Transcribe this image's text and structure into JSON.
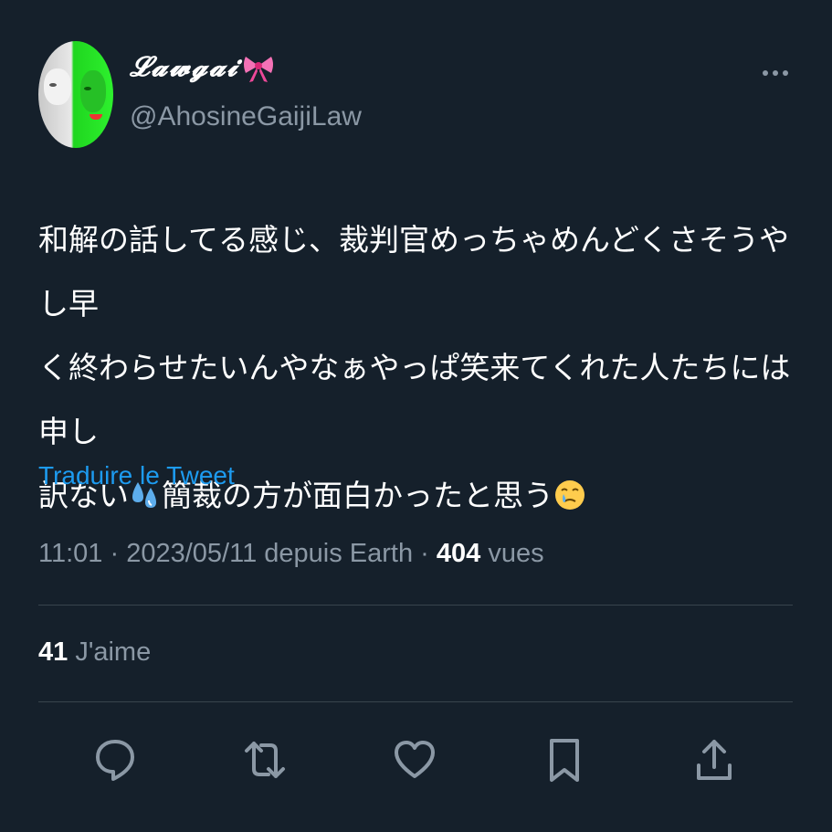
{
  "author": {
    "display_name": "𝓛𝓪𝔀𝓰𝓪𝓲",
    "display_name_emoji": "ribbon",
    "handle": "@AhosineGaijiLaw",
    "avatar_icon": "avatar-image"
  },
  "header": {
    "more_icon": "more-dots-icon"
  },
  "tweet": {
    "text_line1": "和解の話してる感じ、裁判官めっちゃめんどくさそうやし早",
    "text_line2": "く終わらせたいんやなぁやっぱ笑来てくれた人たちには申し",
    "text_line3_a": "訳ない",
    "text_line3_b": "簡裁の方が面白かったと思う",
    "emoji_1": "sweat-droplets",
    "emoji_2": "face-holding-back-tears"
  },
  "translate_label": "Traduire le Tweet",
  "meta": {
    "time": "11:01",
    "separator": " · ",
    "date": "2023/05/11",
    "source": "depuis Earth",
    "views_count": "404",
    "views_label": "vues"
  },
  "likes": {
    "count": "41",
    "label": "J'aime"
  },
  "actions": [
    "reply-icon",
    "retweet-icon",
    "like-icon",
    "bookmark-icon",
    "share-icon"
  ],
  "colors": {
    "background": "#15202b",
    "accent": "#1d9bf0",
    "secondary_text": "#8b98a5",
    "divider": "#38444d"
  }
}
